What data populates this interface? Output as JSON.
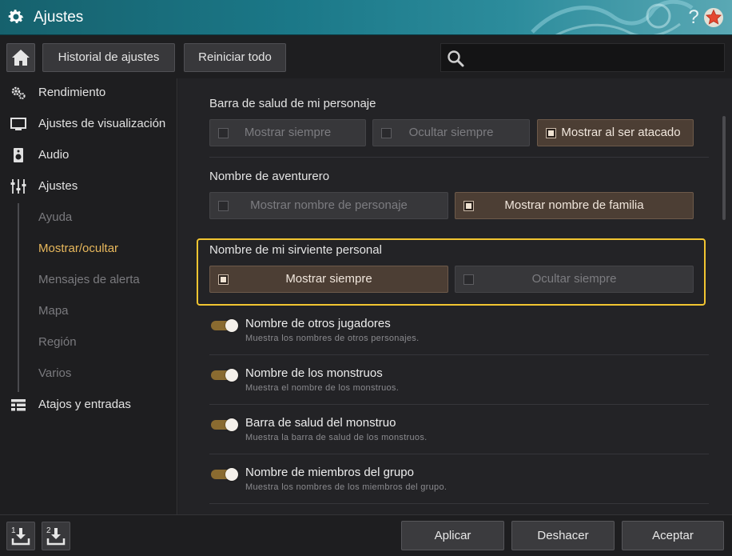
{
  "window": {
    "title": "Ajustes"
  },
  "toolbar": {
    "history_label": "Historial de ajustes",
    "reset_label": "Reiniciar todo",
    "search_placeholder": ""
  },
  "sidebar": {
    "items": [
      {
        "label": "Rendimiento",
        "icon": "gears-icon"
      },
      {
        "label": "Ajustes de visualización",
        "icon": "monitor-icon"
      },
      {
        "label": "Audio",
        "icon": "speaker-icon"
      },
      {
        "label": "Ajustes",
        "icon": "sliders-icon"
      },
      {
        "label": "Ayuda"
      },
      {
        "label": "Mostrar/ocultar",
        "active": true
      },
      {
        "label": "Mensajes de alerta"
      },
      {
        "label": "Mapa"
      },
      {
        "label": "Región"
      },
      {
        "label": "Varios"
      },
      {
        "label": "Atajos y entradas",
        "icon": "keyboard-icon"
      }
    ]
  },
  "main": {
    "health_bar": {
      "label": "Barra de salud de mi personaje",
      "options": [
        "Mostrar siempre",
        "Ocultar siempre",
        "Mostrar al ser atacado"
      ],
      "selected": 2
    },
    "adventurer_name": {
      "label": "Nombre de aventurero",
      "options": [
        "Mostrar nombre de personaje",
        "Mostrar nombre de familia"
      ],
      "selected": 1
    },
    "servant_name": {
      "label": "Nombre de mi sirviente personal",
      "options": [
        "Mostrar siempre",
        "Ocultar siempre"
      ],
      "selected": 0
    },
    "toggles": [
      {
        "title": "Nombre de otros jugadores",
        "desc": "Muestra los nombres de otros personajes.",
        "on": true
      },
      {
        "title": "Nombre de los monstruos",
        "desc": "Muestra el nombre de los monstruos.",
        "on": true
      },
      {
        "title": "Barra de salud del monstruo",
        "desc": "Muestra la barra de salud de los monstruos.",
        "on": true
      },
      {
        "title": "Nombre de miembros del grupo",
        "desc": "Muestra los nombres de los miembros del grupo.",
        "on": true
      }
    ]
  },
  "footer": {
    "apply_label": "Aplicar",
    "undo_label": "Deshacer",
    "accept_label": "Aceptar",
    "slot_1_badge": "1",
    "slot_2_badge": "2"
  },
  "colors": {
    "accent": "#e8b85c",
    "highlight": "#f2c531",
    "titlebar": "#1b7888",
    "selected_option": "#4c3e34"
  }
}
